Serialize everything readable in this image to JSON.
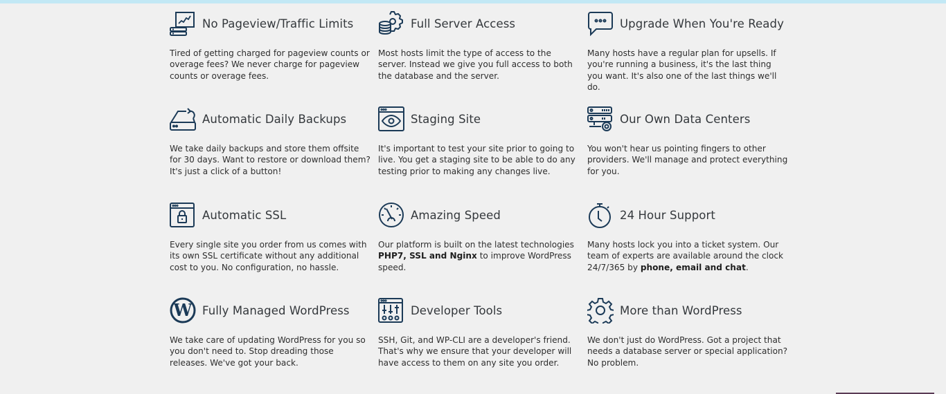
{
  "colors": {
    "top_bar": "#c2e8f5",
    "icon_stroke": "#1b3a57",
    "background": "#f0f0f0",
    "bottom_bar": "#5a3a55"
  },
  "features": [
    {
      "icon": "traffic-chart-server-icon",
      "title": "No Pageview/Traffic Limits",
      "desc_parts": [
        {
          "text": "Tired of getting charged for pageview counts or overage fees? We never charge for pageview counts or overage fees.",
          "bold": false
        }
      ]
    },
    {
      "icon": "database-gear-icon",
      "title": "Full Server Access",
      "desc_parts": [
        {
          "text": "Most hosts limit the type of access to the server. Instead we give you full access to both the database and the server.",
          "bold": false
        }
      ]
    },
    {
      "icon": "chat-bubble-icon",
      "title": "Upgrade When You're Ready",
      "desc_parts": [
        {
          "text": "Many hosts have a regular plan for upsells. If you're running a business, it's the last thing you want. It's also one of the last things we'll do.",
          "bold": false
        }
      ]
    },
    {
      "icon": "backup-drive-icon",
      "title": "Automatic Daily Backups",
      "desc_parts": [
        {
          "text": "We take daily backups and store them offsite for 30 days. Want to restore or download them? It's just a click of a button!",
          "bold": false
        }
      ]
    },
    {
      "icon": "browser-eye-icon",
      "title": "Staging Site",
      "desc_parts": [
        {
          "text": "It's important to test your site prior to going to live. You get a staging site to be able to do any testing prior to making any changes live.",
          "bold": false
        }
      ]
    },
    {
      "icon": "server-rack-gear-icon",
      "title": "Our Own Data Centers",
      "desc_parts": [
        {
          "text": "You won't hear us pointing fingers to other providers. We'll manage and protect everything for you.",
          "bold": false
        }
      ]
    },
    {
      "icon": "browser-lock-icon",
      "title": "Automatic SSL",
      "desc_parts": [
        {
          "text": "Every single site you order from us comes with its own SSL certificate without any additional cost to you. No configuration, no hassle.",
          "bold": false
        }
      ]
    },
    {
      "icon": "speedometer-icon",
      "title": "Amazing Speed",
      "desc_parts": [
        {
          "text": "Our platform is built on the latest technologies ",
          "bold": false
        },
        {
          "text": "PHP7, SSL and Nginx",
          "bold": true
        },
        {
          "text": " to improve WordPress speed.",
          "bold": false
        }
      ]
    },
    {
      "icon": "stopwatch-icon",
      "title": "24 Hour Support",
      "desc_parts": [
        {
          "text": "Many hosts lock you into a ticket system. Our team of experts are available around the clock 24/7/365 by ",
          "bold": false
        },
        {
          "text": "phone, email and chat",
          "bold": true
        },
        {
          "text": ".",
          "bold": false
        }
      ]
    },
    {
      "icon": "wordpress-logo-icon",
      "title": "Fully Managed WordPress",
      "desc_parts": [
        {
          "text": "We take care of updating WordPress for you so you don't need to. Stop dreading those releases. We've got your back.",
          "bold": false
        }
      ]
    },
    {
      "icon": "browser-sliders-icon",
      "title": "Developer Tools",
      "desc_parts": [
        {
          "text": "SSH, Git, and WP-CLI are a developer's friend. That's why we ensure that your developer will have access to them on any site you order.",
          "bold": false
        }
      ]
    },
    {
      "icon": "gear-icon",
      "title": "More than WordPress",
      "desc_parts": [
        {
          "text": "We don't just do WordPress. Got a project that needs a database server or special application? No problem.",
          "bold": false
        }
      ]
    }
  ]
}
